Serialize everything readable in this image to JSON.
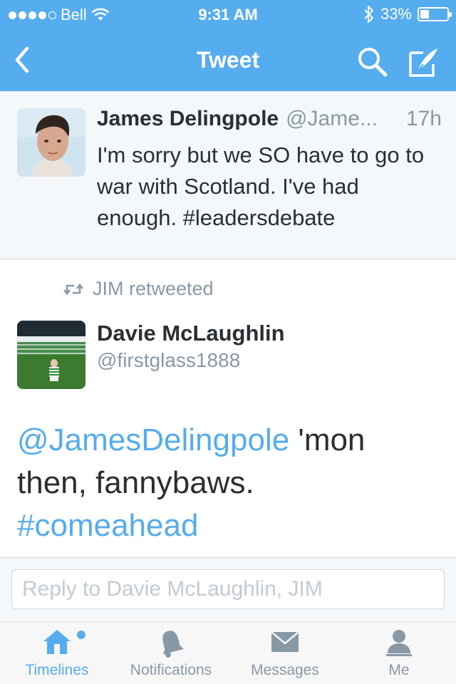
{
  "status_bar": {
    "carrier": "Bell",
    "time": "9:31 AM",
    "battery": "33%",
    "battery_level": 0.33
  },
  "nav": {
    "title": "Tweet",
    "icons": [
      "back-chevron-icon",
      "search-icon",
      "compose-icon"
    ]
  },
  "parent_tweet": {
    "name": "James Delingpole",
    "handle": "@Jame...",
    "age": "17h",
    "text": "I'm sorry but we SO have to go to war with Scotland. I've had enough. #leadersdebate"
  },
  "retweet": {
    "retweeted_by": "JIM retweeted",
    "name": "Davie McLaughlin",
    "handle": "@firstglass1888",
    "text_parts": {
      "mention": "@JamesDelingpole",
      "body": " 'mon then, fannybaws. ",
      "hashtag": "#comeahead"
    }
  },
  "reply": {
    "placeholder": "Reply to Davie McLaughlin, JIM"
  },
  "tabbar": {
    "items": [
      {
        "label": "Timelines",
        "icon": "home-icon",
        "active": true
      },
      {
        "label": "Notifications",
        "icon": "bell-icon",
        "active": false
      },
      {
        "label": "Messages",
        "icon": "envelope-icon",
        "active": false
      },
      {
        "label": "Me",
        "icon": "person-icon",
        "active": false
      }
    ]
  },
  "colors": {
    "brand": "#55acee",
    "text": "#292f33",
    "muted": "#8899a6"
  }
}
